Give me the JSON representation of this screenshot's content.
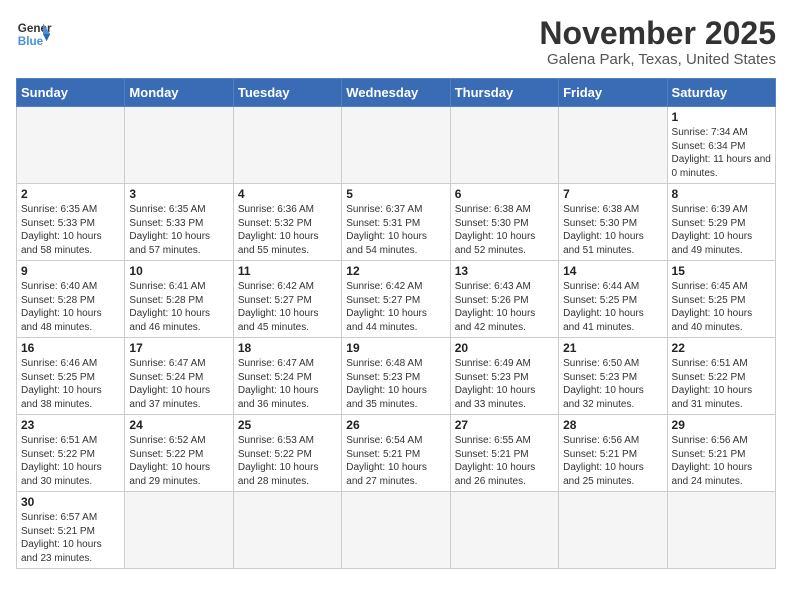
{
  "logo": {
    "line1": "General",
    "line2": "Blue"
  },
  "title": "November 2025",
  "location": "Galena Park, Texas, United States",
  "weekdays": [
    "Sunday",
    "Monday",
    "Tuesday",
    "Wednesday",
    "Thursday",
    "Friday",
    "Saturday"
  ],
  "weeks": [
    [
      {
        "day": "",
        "info": ""
      },
      {
        "day": "",
        "info": ""
      },
      {
        "day": "",
        "info": ""
      },
      {
        "day": "",
        "info": ""
      },
      {
        "day": "",
        "info": ""
      },
      {
        "day": "",
        "info": ""
      },
      {
        "day": "1",
        "info": "Sunrise: 7:34 AM\nSunset: 6:34 PM\nDaylight: 11 hours and 0 minutes."
      }
    ],
    [
      {
        "day": "2",
        "info": "Sunrise: 6:35 AM\nSunset: 5:33 PM\nDaylight: 10 hours and 58 minutes."
      },
      {
        "day": "3",
        "info": "Sunrise: 6:35 AM\nSunset: 5:33 PM\nDaylight: 10 hours and 57 minutes."
      },
      {
        "day": "4",
        "info": "Sunrise: 6:36 AM\nSunset: 5:32 PM\nDaylight: 10 hours and 55 minutes."
      },
      {
        "day": "5",
        "info": "Sunrise: 6:37 AM\nSunset: 5:31 PM\nDaylight: 10 hours and 54 minutes."
      },
      {
        "day": "6",
        "info": "Sunrise: 6:38 AM\nSunset: 5:30 PM\nDaylight: 10 hours and 52 minutes."
      },
      {
        "day": "7",
        "info": "Sunrise: 6:38 AM\nSunset: 5:30 PM\nDaylight: 10 hours and 51 minutes."
      },
      {
        "day": "8",
        "info": "Sunrise: 6:39 AM\nSunset: 5:29 PM\nDaylight: 10 hours and 49 minutes."
      }
    ],
    [
      {
        "day": "9",
        "info": "Sunrise: 6:40 AM\nSunset: 5:28 PM\nDaylight: 10 hours and 48 minutes."
      },
      {
        "day": "10",
        "info": "Sunrise: 6:41 AM\nSunset: 5:28 PM\nDaylight: 10 hours and 46 minutes."
      },
      {
        "day": "11",
        "info": "Sunrise: 6:42 AM\nSunset: 5:27 PM\nDaylight: 10 hours and 45 minutes."
      },
      {
        "day": "12",
        "info": "Sunrise: 6:42 AM\nSunset: 5:27 PM\nDaylight: 10 hours and 44 minutes."
      },
      {
        "day": "13",
        "info": "Sunrise: 6:43 AM\nSunset: 5:26 PM\nDaylight: 10 hours and 42 minutes."
      },
      {
        "day": "14",
        "info": "Sunrise: 6:44 AM\nSunset: 5:25 PM\nDaylight: 10 hours and 41 minutes."
      },
      {
        "day": "15",
        "info": "Sunrise: 6:45 AM\nSunset: 5:25 PM\nDaylight: 10 hours and 40 minutes."
      }
    ],
    [
      {
        "day": "16",
        "info": "Sunrise: 6:46 AM\nSunset: 5:25 PM\nDaylight: 10 hours and 38 minutes."
      },
      {
        "day": "17",
        "info": "Sunrise: 6:47 AM\nSunset: 5:24 PM\nDaylight: 10 hours and 37 minutes."
      },
      {
        "day": "18",
        "info": "Sunrise: 6:47 AM\nSunset: 5:24 PM\nDaylight: 10 hours and 36 minutes."
      },
      {
        "day": "19",
        "info": "Sunrise: 6:48 AM\nSunset: 5:23 PM\nDaylight: 10 hours and 35 minutes."
      },
      {
        "day": "20",
        "info": "Sunrise: 6:49 AM\nSunset: 5:23 PM\nDaylight: 10 hours and 33 minutes."
      },
      {
        "day": "21",
        "info": "Sunrise: 6:50 AM\nSunset: 5:23 PM\nDaylight: 10 hours and 32 minutes."
      },
      {
        "day": "22",
        "info": "Sunrise: 6:51 AM\nSunset: 5:22 PM\nDaylight: 10 hours and 31 minutes."
      }
    ],
    [
      {
        "day": "23",
        "info": "Sunrise: 6:51 AM\nSunset: 5:22 PM\nDaylight: 10 hours and 30 minutes."
      },
      {
        "day": "24",
        "info": "Sunrise: 6:52 AM\nSunset: 5:22 PM\nDaylight: 10 hours and 29 minutes."
      },
      {
        "day": "25",
        "info": "Sunrise: 6:53 AM\nSunset: 5:22 PM\nDaylight: 10 hours and 28 minutes."
      },
      {
        "day": "26",
        "info": "Sunrise: 6:54 AM\nSunset: 5:21 PM\nDaylight: 10 hours and 27 minutes."
      },
      {
        "day": "27",
        "info": "Sunrise: 6:55 AM\nSunset: 5:21 PM\nDaylight: 10 hours and 26 minutes."
      },
      {
        "day": "28",
        "info": "Sunrise: 6:56 AM\nSunset: 5:21 PM\nDaylight: 10 hours and 25 minutes."
      },
      {
        "day": "29",
        "info": "Sunrise: 6:56 AM\nSunset: 5:21 PM\nDaylight: 10 hours and 24 minutes."
      }
    ],
    [
      {
        "day": "30",
        "info": "Sunrise: 6:57 AM\nSunset: 5:21 PM\nDaylight: 10 hours and 23 minutes."
      },
      {
        "day": "",
        "info": ""
      },
      {
        "day": "",
        "info": ""
      },
      {
        "day": "",
        "info": ""
      },
      {
        "day": "",
        "info": ""
      },
      {
        "day": "",
        "info": ""
      },
      {
        "day": "",
        "info": ""
      }
    ]
  ]
}
